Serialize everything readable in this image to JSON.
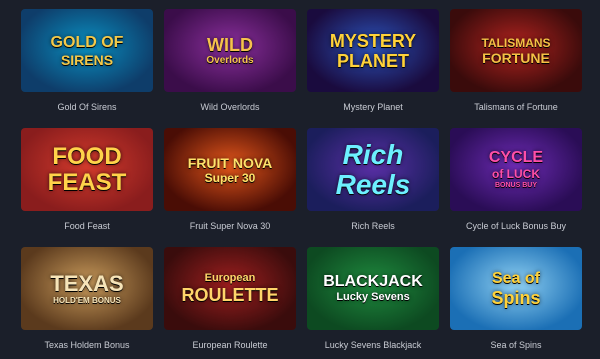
{
  "games": [
    {
      "caption": "Gold Of Sirens",
      "art_lines": [
        "GOLD OF",
        "SIRENS"
      ],
      "colors": {
        "bg1": "#0e3d6a",
        "bg2": "#0a8fc0",
        "text": "#f3c94a"
      }
    },
    {
      "caption": "Wild Overlords",
      "art_lines": [
        "WILD",
        "Overlords"
      ],
      "colors": {
        "bg1": "#3b0d4a",
        "bg2": "#8a2f9c",
        "text": "#f6c24d"
      }
    },
    {
      "caption": "Mystery Planet",
      "art_lines": [
        "MYSTERY",
        "PLANET"
      ],
      "colors": {
        "bg1": "#1a0b3e",
        "bg2": "#2b52b8",
        "text": "#ffd23a"
      }
    },
    {
      "caption": "Talismans of Fortune",
      "art_lines": [
        "TALISMANS",
        "FORTUNE"
      ],
      "colors": {
        "bg1": "#3a0b0b",
        "bg2": "#b0231f",
        "text": "#f5c145"
      }
    },
    {
      "caption": "Food Feast",
      "art_lines": [
        "FOOD",
        "FEAST"
      ],
      "colors": {
        "bg1": "#8a1d1d",
        "bg2": "#d23a2c",
        "text": "#ffd34a"
      }
    },
    {
      "caption": "Fruit Super Nova 30",
      "art_lines": [
        "FRUIT NOVA",
        "Super 30"
      ],
      "colors": {
        "bg1": "#4a0d05",
        "bg2": "#e2561b",
        "text": "#ffe26a"
      }
    },
    {
      "caption": "Rich Reels",
      "art_lines": [
        "Rich",
        "Reels"
      ],
      "colors": {
        "bg1": "#1b1e5c",
        "bg2": "#5a2fa6",
        "text": "#6df0ff"
      }
    },
    {
      "caption": "Cycle of Luck Bonus Buy",
      "art_lines": [
        "CYCLE",
        "of LUCK",
        "BONUS BUY"
      ],
      "colors": {
        "bg1": "#2a0d56",
        "bg2": "#6d2bb4",
        "text": "#ff4fa8"
      }
    },
    {
      "caption": "Texas Holdem Bonus",
      "art_lines": [
        "TEXAS",
        "HOLD'EM BONUS"
      ],
      "colors": {
        "bg1": "#5b3a1d",
        "bg2": "#c89a5b",
        "text": "#f6e4b8"
      }
    },
    {
      "caption": "European Roulette",
      "art_lines": [
        "European",
        "ROULETTE"
      ],
      "colors": {
        "bg1": "#3a0c0c",
        "bg2": "#9e1f1f",
        "text": "#ffd56a"
      }
    },
    {
      "caption": "Lucky Sevens Blackjack",
      "art_lines": [
        "BLACKJACK",
        "Lucky Sevens"
      ],
      "colors": {
        "bg1": "#0d4a21",
        "bg2": "#1f8a3e",
        "text": "#ffffff"
      }
    },
    {
      "caption": "Sea of Spins",
      "art_lines": [
        "Sea of",
        "Spins"
      ],
      "colors": {
        "bg1": "#1b6fb5",
        "bg2": "#8fd0f2",
        "text": "#ffd23a"
      }
    }
  ]
}
